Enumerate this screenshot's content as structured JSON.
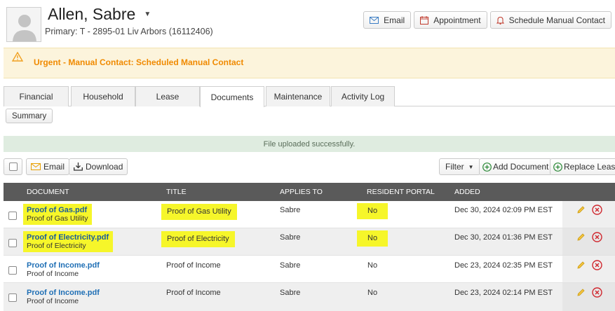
{
  "header": {
    "name": "Allen, Sabre",
    "primary": "Primary: T - 2895-01 Liv Arbors (16112406)",
    "buttons": {
      "email": "Email",
      "appointment": "Appointment",
      "schedule": "Schedule Manual Contact"
    }
  },
  "alert": {
    "text": "Urgent - Manual Contact: Scheduled Manual Contact"
  },
  "tabs": [
    {
      "label": "Financial"
    },
    {
      "label": "Household"
    },
    {
      "label": "Lease"
    },
    {
      "label": "Documents"
    },
    {
      "label": "Maintenance"
    },
    {
      "label": "Activity Log"
    }
  ],
  "active_tab": "Documents",
  "summary_label": "Summary",
  "success_message": "File uploaded successfully.",
  "toolbar": {
    "email": "Email",
    "download": "Download",
    "filter": "Filter",
    "add_document": "Add Document",
    "replace_lease": "Replace Lease"
  },
  "columns": {
    "document": "DOCUMENT",
    "title": "TITLE",
    "applies_to": "APPLIES TO",
    "resident_portal": "RESIDENT PORTAL",
    "added": "ADDED"
  },
  "rows": [
    {
      "file": "Proof of Gas.pdf",
      "desc": "Proof of Gas Utility",
      "title": "Proof of Gas Utility",
      "applies_to": "Sabre",
      "portal": "No",
      "added": "Dec 30, 2024 02:09 PM EST"
    },
    {
      "file": "Proof of Electricity.pdf",
      "desc": "Proof of Electricity",
      "title": "Proof of Electricity",
      "applies_to": "Sabre",
      "portal": "No",
      "added": "Dec 30, 2024 01:36 PM EST"
    },
    {
      "file": "Proof of Income.pdf",
      "desc": "Proof of Income",
      "title": "Proof of Income",
      "applies_to": "Sabre",
      "portal": "No",
      "added": "Dec 23, 2024 02:35 PM EST"
    },
    {
      "file": "Proof of Income.pdf",
      "desc": "Proof of Income",
      "title": "Proof of Income",
      "applies_to": "Sabre",
      "portal": "No",
      "added": "Dec 23, 2024 02:14 PM EST"
    }
  ],
  "colors": {
    "alert_text": "#f08a00",
    "link": "#1f6fb5",
    "highlight": "#f6f62a",
    "grid_header": "#5a5a5a",
    "success_bg": "#dfece0"
  },
  "icons": [
    "avatar-icon",
    "mail-icon",
    "calendar-icon",
    "bell-icon",
    "warning-icon",
    "download-icon",
    "plus-circle-icon",
    "pencil-icon",
    "delete-icon"
  ]
}
